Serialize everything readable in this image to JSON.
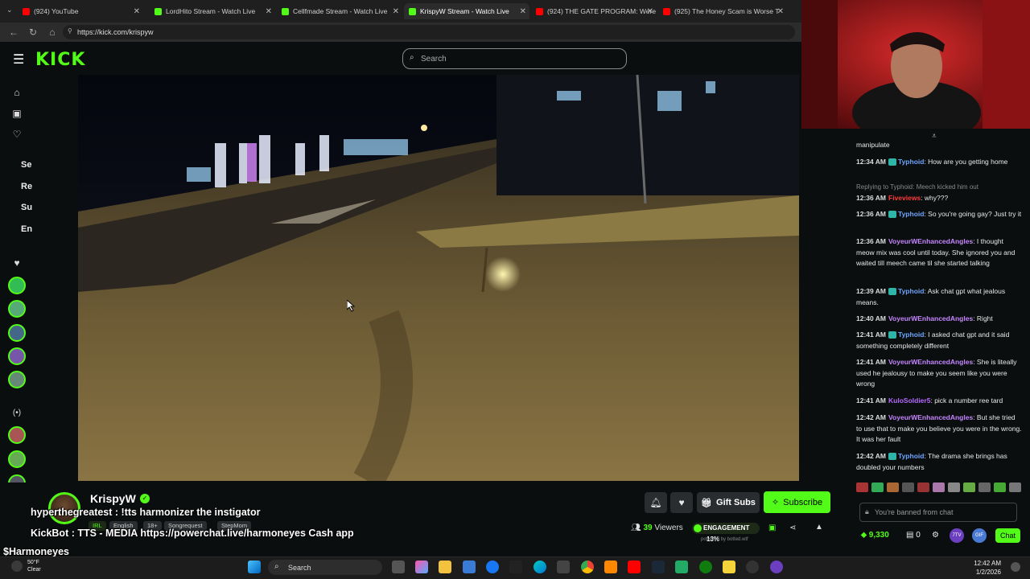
{
  "browser": {
    "tabs": [
      {
        "title": "(924) YouTube",
        "favicon_color": "#ff0000"
      },
      {
        "title": "LordHito Stream - Watch Live",
        "favicon_color": "#53fc18"
      },
      {
        "title": "Cellfmade Stream - Watch Live",
        "favicon_color": "#53fc18"
      },
      {
        "title": "KrispyW Stream - Watch Live",
        "favicon_color": "#53fc18"
      },
      {
        "title": "(924) THE GATE PROGRAM: Were",
        "favicon_color": "#ff0000"
      },
      {
        "title": "(925) The Honey Scam is Worse T",
        "favicon_color": "#ff0000"
      }
    ],
    "url": "https://kick.com/krispyw"
  },
  "kick": {
    "logo": "KICK",
    "search_placeholder": "Search",
    "sidebar_sections": [
      "Se",
      "Re",
      "Su",
      "En"
    ],
    "accent": "#53fc18"
  },
  "stream": {
    "streamer": "KrispyW",
    "tags": [
      "IRL",
      "English",
      "18+",
      "Songrequest",
      "StepMom"
    ],
    "viewers_count": "39",
    "viewers_label": "Viewers",
    "engagement_label": "ENGAGEMENT",
    "engagement_value": "13%",
    "powered_by": "powered by botted.wtf",
    "gift_subs_label": "Gift Subs",
    "subscribe_label": "Subscribe",
    "overlay_lines": [
      "hyperthegreatest : !tts harmonizer the instigator",
      "KickBot : TTS - MEDIA https://powerchat.live/harmoneyes Cash app",
      "$Harmoneyes"
    ]
  },
  "chat": {
    "first_line": "manipulate",
    "reply_context": "Replying to Typhoid: Meech kicked him out",
    "messages": [
      {
        "time": "12:34 AM",
        "user": "Typhoid",
        "color": "#6ea5ff",
        "badge": true,
        "text": "How are you getting home"
      },
      {
        "time": "12:36 AM",
        "user": "Fiveviews",
        "color": "#ff3b3b",
        "badge": false,
        "text": "why???"
      },
      {
        "time": "12:36 AM",
        "user": "Typhoid",
        "color": "#6ea5ff",
        "badge": true,
        "text": "So you're going gay? Just try it"
      },
      {
        "time": "12:36 AM",
        "user": "VoyeurWEnhancedAngles",
        "color": "#c586ff",
        "badge": false,
        "text": "I thought meow mix was cool until today. She ignored you and waited till meech came til she started talking"
      },
      {
        "time": "12:39 AM",
        "user": "Typhoid",
        "color": "#6ea5ff",
        "badge": true,
        "text": "Ask chat gpt what jealous means."
      },
      {
        "time": "12:40 AM",
        "user": "VoyeurWEnhancedAngles",
        "color": "#c586ff",
        "badge": false,
        "text": "Right"
      },
      {
        "time": "12:41 AM",
        "user": "Typhoid",
        "color": "#6ea5ff",
        "badge": true,
        "text": "I asked chat gpt and it said something completely different"
      },
      {
        "time": "12:41 AM",
        "user": "VoyeurWEnhancedAngles",
        "color": "#c586ff",
        "badge": false,
        "text": "She is liteally used he jealousy to make you seem like you were wrong"
      },
      {
        "time": "12:41 AM",
        "user": "KuloSoldier5",
        "color": "#b56bff",
        "badge": false,
        "text": "pick a number ree tard"
      },
      {
        "time": "12:42 AM",
        "user": "VoyeurWEnhancedAngles",
        "color": "#c586ff",
        "badge": false,
        "text": "But she tried to use that to make you believe you were in the wrong. It was her fault"
      },
      {
        "time": "12:42 AM",
        "user": "Typhoid",
        "color": "#6ea5ff",
        "badge": true,
        "text": "The drama she brings has doubled your numbers"
      }
    ],
    "input_placeholder": "You're banned from chat",
    "points": "9,330",
    "redeem_count": "0",
    "chat_button": "Chat"
  },
  "taskbar": {
    "search_label": "Search",
    "weather_temp": "50°F",
    "weather_desc": "Clear",
    "time": "12:42 AM",
    "date": "1/2/2026"
  }
}
